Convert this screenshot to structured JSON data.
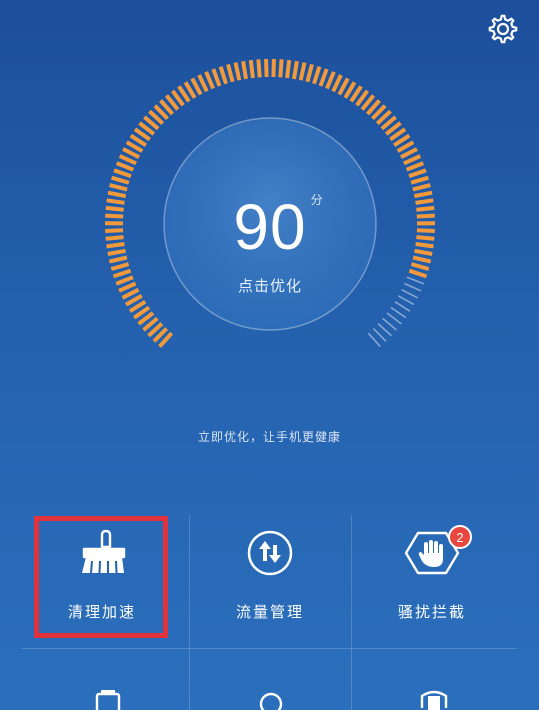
{
  "header": {
    "settings_icon": "gear-icon"
  },
  "score": {
    "value": "90",
    "unit": "分",
    "action": "点击优化"
  },
  "tagline": "立即优化，让手机更健康",
  "colors": {
    "accent": "#f29a3b",
    "background": "#2461ae",
    "badge": "#e8463e",
    "highlight": "#e0333b"
  },
  "gauge": {
    "level_percent": 90
  },
  "tiles": [
    {
      "label": "清理加速",
      "icon": "broom-icon",
      "highlighted": true
    },
    {
      "label": "流量管理",
      "icon": "data-transfer-icon"
    },
    {
      "label": "骚扰拦截",
      "icon": "block-hand-icon",
      "badge": "2"
    }
  ],
  "tiles_row2_icons": [
    "battery-icon",
    "location-pin-icon",
    "shield-icon"
  ]
}
